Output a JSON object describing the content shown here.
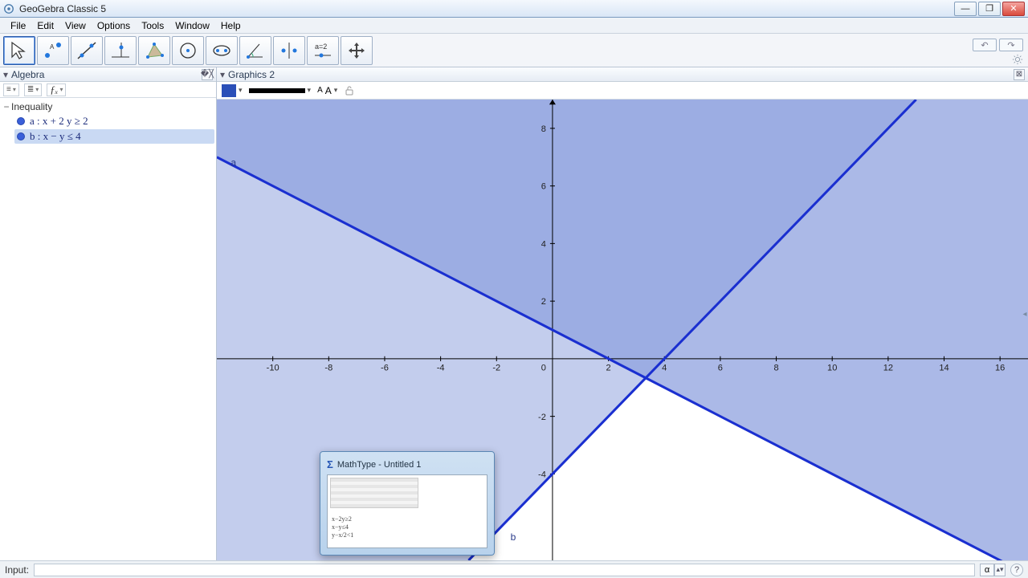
{
  "title": "GeoGebra Classic 5",
  "menu": [
    "File",
    "Edit",
    "View",
    "Options",
    "Tools",
    "Window",
    "Help"
  ],
  "tool_tips": [
    "Move",
    "Point",
    "Line",
    "Perpendicular Line",
    "Polygon",
    "Circle",
    "Ellipse",
    "Angle",
    "Reflect",
    "Slider",
    "Move Graphics View"
  ],
  "panels": {
    "algebra": "Algebra",
    "graphics": "Graphics 2"
  },
  "alg_toolbar": {
    "fx": "ƒₓ"
  },
  "category": "Inequality",
  "items": [
    {
      "name": "a",
      "expr": "a : x + 2 y ≥ 2",
      "selected": false
    },
    {
      "name": "b",
      "expr": "b : x − y ≤ 4",
      "selected": true
    }
  ],
  "gtoolbar": {
    "textsize": "A A"
  },
  "input_label": "Input:",
  "alpha": "α",
  "preview": {
    "title": "MathType - Untitled 1",
    "lines": [
      "x−2y≥2",
      "x−y≤4",
      "y−x/2<1"
    ]
  },
  "undo": "↶",
  "redo": "↷",
  "chart_data": {
    "type": "inequality-plot",
    "xrange": [
      -12,
      17
    ],
    "yrange": [
      -7,
      9
    ],
    "xticks": [
      -10,
      -8,
      -6,
      -4,
      -2,
      0,
      2,
      4,
      6,
      8,
      10,
      12,
      14,
      16
    ],
    "yticks": [
      -4,
      -2,
      2,
      4,
      6,
      8
    ],
    "series": [
      {
        "name": "a",
        "label_pos": [
          -11.5,
          6.7
        ],
        "line": "x + 2y = 2",
        "region": "x + 2y ≥ 2",
        "points": [
          [
            -12,
            7
          ],
          [
            17,
            -7.5
          ]
        ]
      },
      {
        "name": "b",
        "label_pos": [
          -1.5,
          -6.3
        ],
        "line": "x - y = 4",
        "region": "x - y ≤ 4",
        "points": [
          [
            -3,
            -7
          ],
          [
            17,
            13
          ]
        ]
      }
    ],
    "intersection_fill": "both regions overlap shaded darker",
    "axis_labels": {
      "x": "",
      "y": ""
    }
  }
}
